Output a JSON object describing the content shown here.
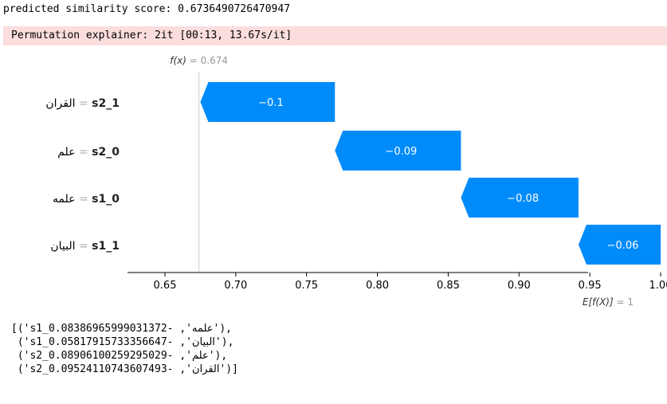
{
  "console": {
    "score_line": "predicted similarity score: 0.6736490726470947",
    "progress_line": "Permutation explainer: 2it [00:13, 13.67s/it]"
  },
  "colors": {
    "bar": "#008bfb",
    "bar_text": "#ffffff",
    "fx_line": "#cccccc",
    "annotation_gray": "#999999"
  },
  "chart_data": {
    "type": "waterfall",
    "title": "",
    "fx_label": "f(x)",
    "fx_value_text": "= 0.674",
    "fx": 0.674,
    "expected_label": "E[f(X)]",
    "expected_value_text": "= 1",
    "expected": 1.0,
    "xlim": [
      0.62,
      1.0
    ],
    "xticks": [
      0.65,
      0.7,
      0.75,
      0.8,
      0.85,
      0.9,
      0.95,
      1.0
    ],
    "xtick_labels": [
      "0.65",
      "0.70",
      "0.75",
      "0.80",
      "0.85",
      "0.90",
      "0.95",
      "1.00"
    ],
    "features": [
      {
        "value": "القران",
        "name": "s2_1",
        "contribution": -0.095,
        "label": "−0.1",
        "start": 0.77,
        "end": 0.675
      },
      {
        "value": "علم",
        "name": "s2_0",
        "contribution": -0.089,
        "label": "−0.09",
        "start": 0.859,
        "end": 0.77
      },
      {
        "value": "علمه",
        "name": "s1_0",
        "contribution": -0.084,
        "label": "−0.08",
        "start": 0.942,
        "end": 0.859
      },
      {
        "value": "البيان",
        "name": "s1_1",
        "contribution": -0.058,
        "label": "−0.06",
        "start": 1.0,
        "end": 0.942
      }
    ]
  },
  "output": {
    "lines": [
      {
        "prefix": "[('s1_0.08386965999031372- ,'",
        "word": "علمه",
        "suffix": "'),"
      },
      {
        "prefix": " ('s1_0.05817915733356647- ,'",
        "word": "البيان",
        "suffix": "'),"
      },
      {
        "prefix": " ('s2_0.08906100259295029- ,'",
        "word": "علم",
        "suffix": "'),"
      },
      {
        "prefix": " ('s2_0.09524110743607493- ,'",
        "word": "القران",
        "suffix": "')]"
      }
    ]
  }
}
